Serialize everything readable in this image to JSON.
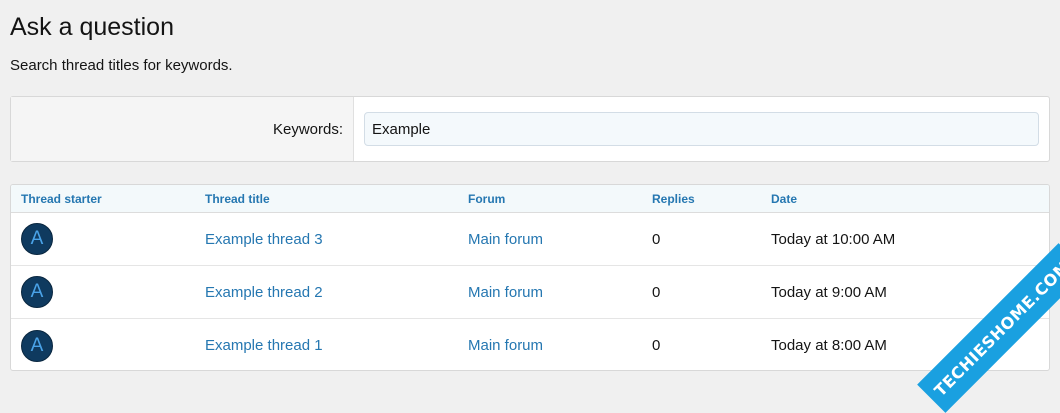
{
  "header": {
    "title": "Ask a question",
    "description": "Search thread titles for keywords."
  },
  "search": {
    "label": "Keywords:",
    "value": "Example"
  },
  "table": {
    "columns": {
      "starter": "Thread starter",
      "title": "Thread title",
      "forum": "Forum",
      "replies": "Replies",
      "date": "Date"
    },
    "rows": [
      {
        "avatar_letter": "A",
        "title": "Example thread 3",
        "forum": "Main forum",
        "replies": "0",
        "date": "Today at 10:00 AM"
      },
      {
        "avatar_letter": "A",
        "title": "Example thread 2",
        "forum": "Main forum",
        "replies": "0",
        "date": "Today at 9:00 AM"
      },
      {
        "avatar_letter": "A",
        "title": "Example thread 1",
        "forum": "Main forum",
        "replies": "0",
        "date": "Today at 8:00 AM"
      }
    ]
  },
  "watermark": {
    "text": "TECHIESHOME.COM"
  },
  "colors": {
    "link": "#2577b1",
    "avatar_bg": "#0f3a5f",
    "watermark_bg": "#1aa0e0"
  }
}
